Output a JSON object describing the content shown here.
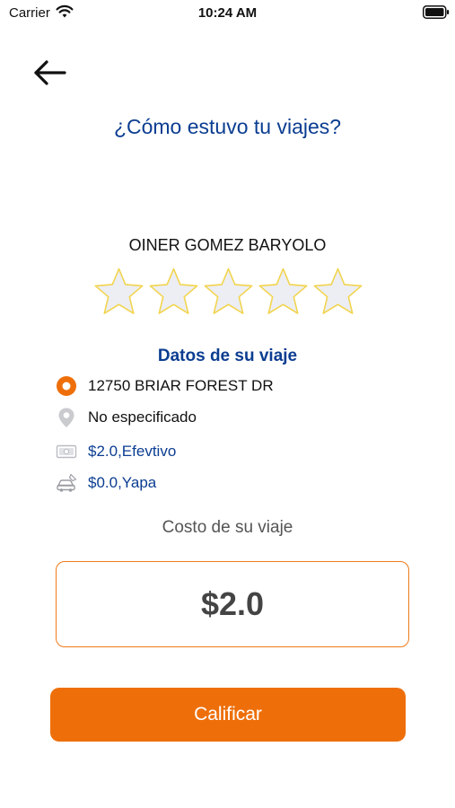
{
  "status_bar": {
    "carrier": "Carrier",
    "time": "10:24 AM"
  },
  "header": {
    "back_icon": "arrow-left-icon",
    "title": "¿Cómo estuvo tu viajes?"
  },
  "driver": {
    "name": "OINER GOMEZ BARYOLO",
    "rating": 0,
    "rating_max": 5
  },
  "trip": {
    "section_title": "Datos de su viaje",
    "origin": "12750 BRIAR FOREST DR",
    "destination": "No especificado",
    "payment": "$2.0,Efevtivo",
    "tip": "$0.0,Yapa"
  },
  "cost": {
    "label": "Costo de su viaje",
    "value": "$2.0"
  },
  "actions": {
    "rate_label": "Calificar"
  },
  "colors": {
    "brand_blue": "#0b3d91",
    "accent_orange": "#ee6f0a",
    "star_fill": "#eceef3",
    "star_stroke": "#f2d44e"
  }
}
